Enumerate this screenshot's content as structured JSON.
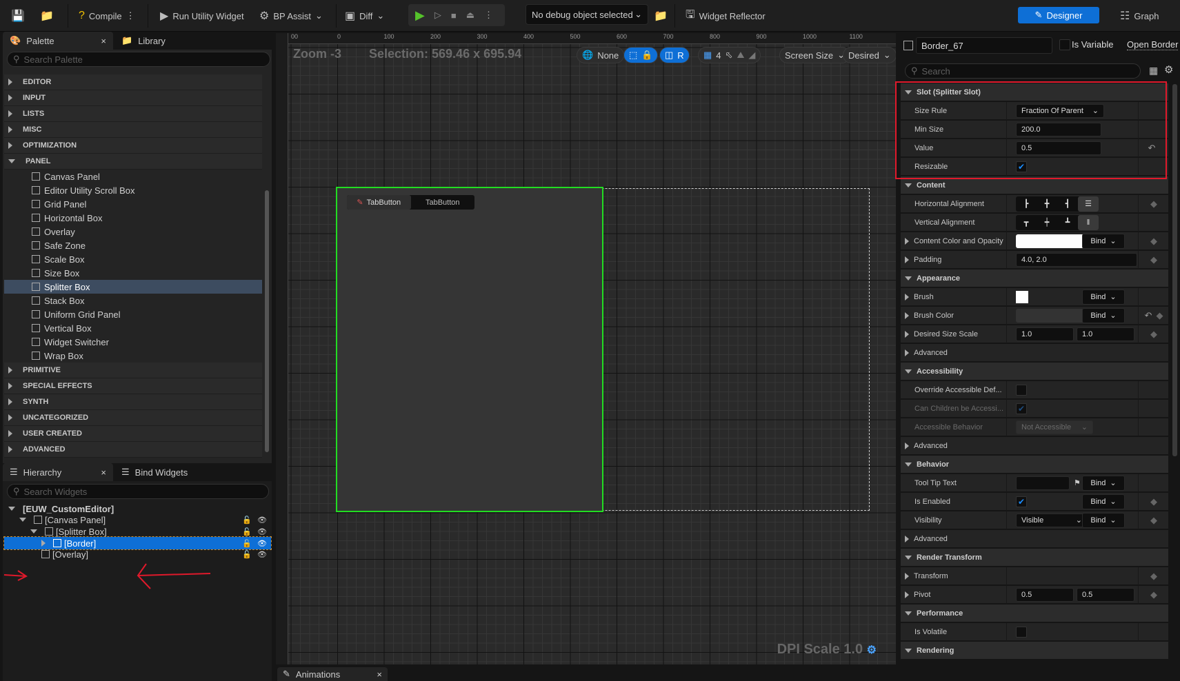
{
  "toolbar": {
    "compile": "Compile",
    "run": "Run Utility Widget",
    "bp_assist": "BP Assist",
    "diff": "Diff",
    "debug_object": "No debug object selected",
    "widget_reflector": "Widget Reflector",
    "designer": "Designer",
    "graph": "Graph",
    "accent": "#0e6fd6"
  },
  "palette": {
    "tab": "Palette",
    "library_tab": "Library",
    "search_placeholder": "Search Palette",
    "categories_before": [
      "EDITOR",
      "INPUT",
      "LISTS",
      "MISC",
      "OPTIMIZATION"
    ],
    "panel_category": "PANEL",
    "panel_items": [
      {
        "label": "Canvas Panel",
        "selected": false
      },
      {
        "label": "Editor Utility Scroll Box",
        "selected": false
      },
      {
        "label": "Grid Panel",
        "selected": false
      },
      {
        "label": "Horizontal Box",
        "selected": false
      },
      {
        "label": "Overlay",
        "selected": false
      },
      {
        "label": "Safe Zone",
        "selected": false
      },
      {
        "label": "Scale Box",
        "selected": false
      },
      {
        "label": "Size Box",
        "selected": false
      },
      {
        "label": "Splitter Box",
        "selected": true
      },
      {
        "label": "Stack Box",
        "selected": false
      },
      {
        "label": "Uniform Grid Panel",
        "selected": false
      },
      {
        "label": "Vertical Box",
        "selected": false
      },
      {
        "label": "Widget Switcher",
        "selected": false
      },
      {
        "label": "Wrap Box",
        "selected": false
      }
    ],
    "categories_after": [
      "PRIMITIVE",
      "SPECIAL EFFECTS",
      "SYNTH",
      "UNCATEGORIZED",
      "USER CREATED",
      "ADVANCED"
    ]
  },
  "hierarchy": {
    "tab": "Hierarchy",
    "bind_tab": "Bind Widgets",
    "search_placeholder": "Search Widgets",
    "items": [
      {
        "label": "[EUW_CustomEditor]",
        "depth": 0,
        "selected": false,
        "icon": "none"
      },
      {
        "label": "[Canvas Panel]",
        "depth": 1,
        "selected": false,
        "icon": "canvas-panel-icon"
      },
      {
        "label": "[Splitter Box]",
        "depth": 2,
        "selected": false,
        "icon": "splitter-box-icon"
      },
      {
        "label": "[Border]",
        "depth": 3,
        "selected": true,
        "icon": "border-icon"
      },
      {
        "label": "[Overlay]",
        "depth": 3,
        "selected": false,
        "icon": "overlay-icon"
      }
    ]
  },
  "designer": {
    "zoom": "Zoom -3",
    "selection": "Selection: 569.46 x 695.94",
    "ruler_labels": [
      "00",
      "0",
      "100",
      "200",
      "300",
      "400",
      "500",
      "600",
      "700",
      "800",
      "900",
      "1000",
      "1100"
    ],
    "view_controls": {
      "none": "None",
      "r": "R",
      "grid_snap": "4",
      "screen_size": "Screen Size",
      "desired": "Desired"
    },
    "tab_buttons": [
      "TabButton",
      "TabButton"
    ],
    "dpi": "DPI Scale 1.0",
    "selection_color": "#22dd22"
  },
  "animations_tab": "Animations",
  "details": {
    "name": "Border_67",
    "is_variable": "Is Variable",
    "open": "Open Border",
    "search_placeholder": "Search",
    "rows": [
      {
        "t": "sec",
        "label": "Slot (Splitter Slot)"
      },
      {
        "t": "prop",
        "label": "Size Rule",
        "kind": "dropdown",
        "value": "Fraction Of Parent"
      },
      {
        "t": "prop",
        "label": "Min Size",
        "kind": "field",
        "value": "200.0"
      },
      {
        "t": "prop",
        "label": "Value",
        "kind": "field",
        "value": "0.5",
        "reset": true
      },
      {
        "t": "prop",
        "label": "Resizable",
        "kind": "check",
        "checked": true
      },
      {
        "t": "sec",
        "label": "Content"
      },
      {
        "t": "prop",
        "label": "Horizontal Alignment",
        "kind": "halign",
        "selected": "fill",
        "key": true
      },
      {
        "t": "prop",
        "label": "Vertical Alignment",
        "kind": "valign",
        "selected": "fill"
      },
      {
        "t": "prop",
        "label": "Content Color and Opacity",
        "kind": "color",
        "color": "#ffffff",
        "bind": "Bind",
        "expand": true,
        "key": true
      },
      {
        "t": "prop",
        "label": "Padding",
        "kind": "wide",
        "value": "4.0, 2.0",
        "expand": true,
        "key": true
      },
      {
        "t": "sec",
        "label": "Appearance"
      },
      {
        "t": "prop",
        "label": "Brush",
        "kind": "swatch",
        "color": "#ffffff",
        "bind": "Bind",
        "expand": true
      },
      {
        "t": "prop",
        "label": "Brush Color",
        "kind": "color",
        "color": "#333333",
        "bind": "Bind",
        "expand": true,
        "reset": true,
        "key": true
      },
      {
        "t": "prop",
        "label": "Desired Size Scale",
        "kind": "two",
        "value": "1.0",
        "value2": "1.0",
        "expand": true,
        "key": true
      },
      {
        "t": "sub",
        "label": "Advanced"
      },
      {
        "t": "sec",
        "label": "Accessibility"
      },
      {
        "t": "prop",
        "label": "Override Accessible Def...",
        "kind": "check",
        "checked": false
      },
      {
        "t": "prop",
        "label": "Can Children be Accessi...",
        "kind": "check",
        "checked": true,
        "dim": true
      },
      {
        "t": "prop",
        "label": "Accessible Behavior",
        "kind": "dropdown",
        "value": "Not Accessible",
        "dim": true
      },
      {
        "t": "sub",
        "label": "Advanced"
      },
      {
        "t": "sec",
        "label": "Behavior"
      },
      {
        "t": "prop",
        "label": "Tool Tip Text",
        "kind": "tooltip",
        "value": "",
        "bind": "Bind"
      },
      {
        "t": "prop",
        "label": "Is Enabled",
        "kind": "check",
        "checked": true,
        "bind": "Bind",
        "key": true
      },
      {
        "t": "prop",
        "label": "Visibility",
        "kind": "dropdown",
        "value": "Visible",
        "bind": "Bind",
        "key": true
      },
      {
        "t": "sub",
        "label": "Advanced"
      },
      {
        "t": "sec",
        "label": "Render Transform"
      },
      {
        "t": "prop",
        "label": "Transform",
        "kind": "empty",
        "expand": true,
        "key": true
      },
      {
        "t": "prop",
        "label": "Pivot",
        "kind": "two",
        "value": "0.5",
        "value2": "0.5",
        "expand": true,
        "key": true
      },
      {
        "t": "sec",
        "label": "Performance"
      },
      {
        "t": "prop",
        "label": "Is Volatile",
        "kind": "check",
        "checked": false
      },
      {
        "t": "sec",
        "label": "Rendering"
      }
    ],
    "annotation_color": "#e0192b"
  }
}
